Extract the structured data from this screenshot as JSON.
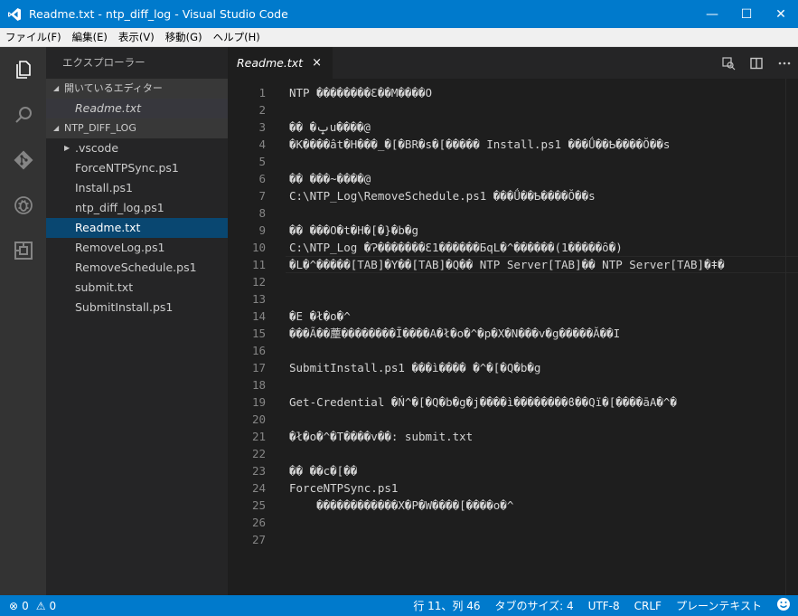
{
  "window": {
    "title": "Readme.txt - ntp_diff_log - Visual Studio Code",
    "minimize": "—",
    "maximize": "☐",
    "close": "✕"
  },
  "menu": [
    "ファイル(F)",
    "編集(E)",
    "表示(V)",
    "移動(G)",
    "ヘルプ(H)"
  ],
  "activity": [
    "explorer-icon",
    "search-icon",
    "git-icon",
    "debug-icon",
    "extensions-icon"
  ],
  "sidebar": {
    "title": "エクスプローラー",
    "open_editors_header": "開いているエディター",
    "open_editors": [
      "Readme.txt"
    ],
    "folder_header": "NTP_DIFF_LOG",
    "items": [
      {
        "label": ".vscode",
        "type": "folder"
      },
      {
        "label": "ForceNTPSync.ps1",
        "type": "file"
      },
      {
        "label": "Install.ps1",
        "type": "file"
      },
      {
        "label": "ntp_diff_log.ps1",
        "type": "file"
      },
      {
        "label": "Readme.txt",
        "type": "file",
        "selected": true
      },
      {
        "label": "RemoveLog.ps1",
        "type": "file"
      },
      {
        "label": "RemoveSchedule.ps1",
        "type": "file"
      },
      {
        "label": "submit.txt",
        "type": "file"
      },
      {
        "label": "SubmitInstall.ps1",
        "type": "file"
      }
    ]
  },
  "editor": {
    "tab_label": "Readme.txt",
    "tab_close": "×",
    "current_line": 11,
    "lines": [
      "NTP ��������Ɛ��M����O",
      "",
      "�� �ݒu����@",
      "�K����ât�H���_�[�BR�s�[����� Install.ps1 ���Ǘ��Ҍ����Ŏ��s",
      "",
      "�� ���~����@",
      "C:\\NTP_Log\\RemoveSchedule.ps1 ���Ǘ��Ҍ����Ŏ��s",
      "",
      "�� ���O�t�H�[�}�b�g",
      "C:\\NTP_Log �Ɂ�������Ɛ1������БqL�^������(1�����ȏ�)",
      "�L�^�����[TAB]�Y��[TAB]�Q�� NTP Server[TAB]�� NTP Server[TAB]�ǂ�",
      "",
      "",
      "�E �ł�o�^",
      "���Ã��薼��������Ī����A�ł�o�^�p�X�N���v�g�����Ă��I",
      "",
      "SubmitInstall.ps1 ���ì���� �^�[�Q�b�g",
      "",
      "Get-Credential �Ń^�[�Q�b�g�j����ì��������ϐ��Qï�[����āA�^�",
      "",
      "�ł�o�^�T����v��: submit.txt",
      "",
      "�� ��c�[��",
      "ForceNTPSync.ps1",
      "    ������������X�P�W����[����o�^",
      "",
      ""
    ]
  },
  "statusbar": {
    "errors_icon": "⊗",
    "errors": "0",
    "warnings_icon": "⚠",
    "warnings": "0",
    "position": "行 11、列 46",
    "tab_size": "タブのサイズ: 4",
    "encoding": "UTF-8",
    "eol": "CRLF",
    "language": "プレーンテキスト",
    "feedback_icon": "smiley-icon"
  },
  "colors": {
    "accent": "#007acc",
    "editor_bg": "#1e1e1e",
    "sidebar_bg": "#252526",
    "activity_bg": "#333333",
    "selected": "#094771"
  }
}
